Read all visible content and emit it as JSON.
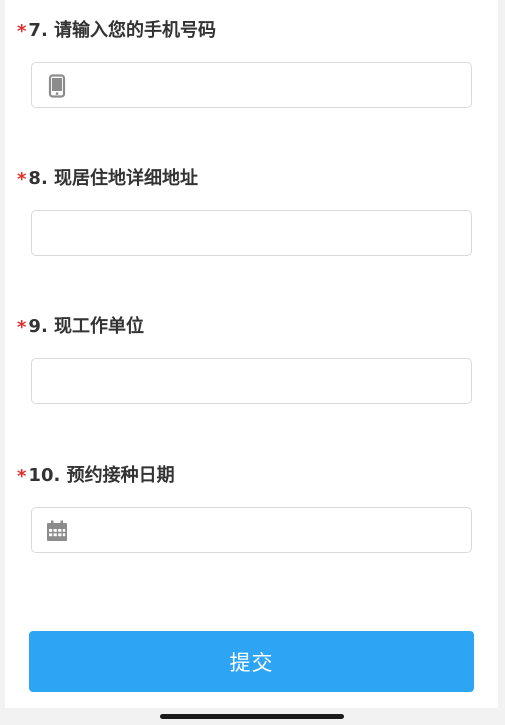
{
  "form": {
    "questions": [
      {
        "required_mark": "*",
        "label": "7. 请输入您的手机号码",
        "value": "",
        "icon": "mobile-phone-icon"
      },
      {
        "required_mark": "*",
        "label": "8. 现居住地详细地址",
        "value": ""
      },
      {
        "required_mark": "*",
        "label": "9. 现工作单位",
        "value": ""
      },
      {
        "required_mark": "*",
        "label": "10. 预约接种日期",
        "value": "",
        "icon": "calendar-icon"
      }
    ],
    "submit_label": "提交"
  },
  "colors": {
    "accent": "#2ea5f4",
    "required": "#e0302a",
    "icon": "#8c8c8c"
  }
}
